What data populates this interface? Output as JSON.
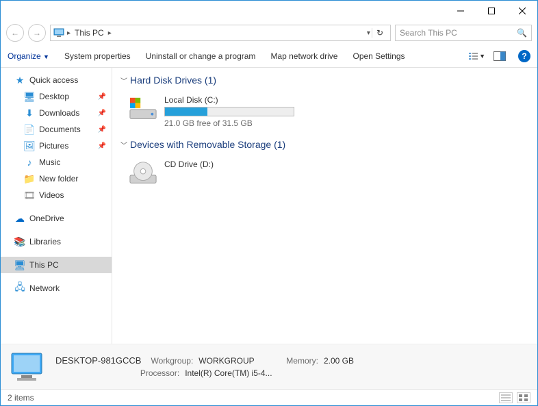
{
  "window": {
    "minimize": "—",
    "maximize": "☐",
    "close": "✕"
  },
  "address": {
    "location": "This PC",
    "search_placeholder": "Search This PC"
  },
  "toolbar": {
    "organize": "Organize",
    "system_properties": "System properties",
    "uninstall": "Uninstall or change a program",
    "map_drive": "Map network drive",
    "open_settings": "Open Settings"
  },
  "sidebar": {
    "quick_access": "Quick access",
    "desktop": "Desktop",
    "downloads": "Downloads",
    "documents": "Documents",
    "pictures": "Pictures",
    "music": "Music",
    "new_folder": "New folder",
    "videos": "Videos",
    "onedrive": "OneDrive",
    "libraries": "Libraries",
    "this_pc": "This PC",
    "network": "Network"
  },
  "content": {
    "hdd_header": "Hard Disk Drives (1)",
    "local_disk": {
      "name": "Local Disk (C:)",
      "free": "21.0 GB free of 31.5 GB",
      "fill_percent": 33
    },
    "removable_header": "Devices with Removable Storage (1)",
    "cd_drive": {
      "name": "CD Drive (D:)"
    }
  },
  "details": {
    "computer_name": "DESKTOP-981GCCB",
    "workgroup_label": "Workgroup:",
    "workgroup": "WORKGROUP",
    "processor_label": "Processor:",
    "processor": "Intel(R) Core(TM) i5-4...",
    "memory_label": "Memory:",
    "memory": "2.00 GB"
  },
  "status": {
    "items": "2 items"
  }
}
